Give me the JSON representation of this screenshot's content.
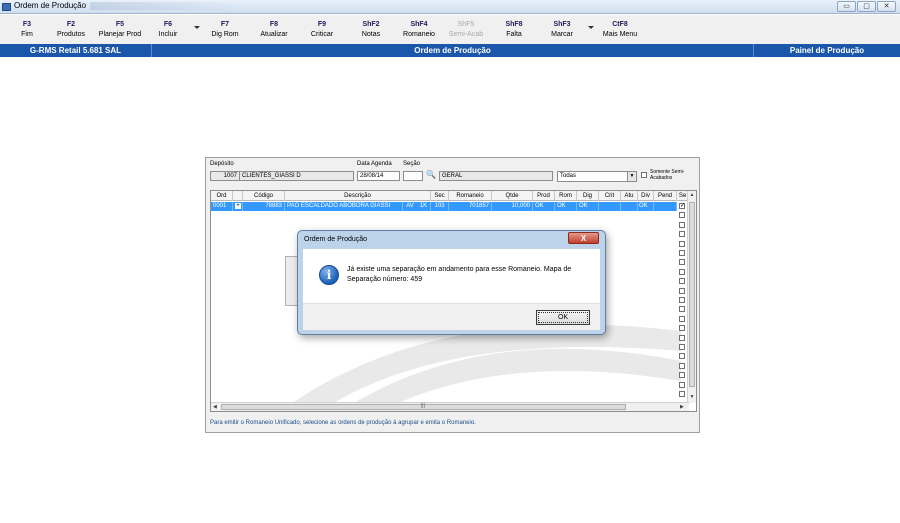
{
  "window": {
    "title": "Ordem de Produção",
    "controls": [
      "▭",
      "▢",
      "✕"
    ]
  },
  "toolbar": {
    "items": [
      {
        "key": "F3",
        "label": "Fim",
        "enabled": true
      },
      {
        "key": "F2",
        "label": "Produtos",
        "enabled": true
      },
      {
        "key": "F5",
        "label": "Planejar Prod",
        "enabled": true
      },
      {
        "key": "F6",
        "label": "Incluir",
        "enabled": true
      },
      {
        "key": "F7",
        "label": "Dig Rom",
        "enabled": true
      },
      {
        "key": "F8",
        "label": "Atualizar",
        "enabled": true
      },
      {
        "key": "F9",
        "label": "Criticar",
        "enabled": true
      },
      {
        "key": "ShF2",
        "label": "Notas",
        "enabled": true
      },
      {
        "key": "ShF4",
        "label": "Romaneio",
        "enabled": true
      },
      {
        "key": "ShF5",
        "label": "Semi-Acab",
        "enabled": false
      },
      {
        "key": "ShF8",
        "label": "Falta",
        "enabled": true
      },
      {
        "key": "ShF3",
        "label": "Marcar",
        "enabled": true
      },
      {
        "key": "CtF8",
        "label": "Mais Menu",
        "enabled": true
      }
    ]
  },
  "header": {
    "left": "G-RMS Retail 5.681 SAL",
    "center": "Ordem de Produção",
    "right": "Painel de Produção"
  },
  "filters": {
    "deposito_label": "Depósito",
    "deposito_code": "1007",
    "deposito_name": "CLIENTES_GIASSI D",
    "data_agenda_label": "Data Agenda",
    "data_agenda_value": "28/08/14",
    "secao_label": "Seção",
    "secao_code": "",
    "secao_name": "GERAL",
    "combo_value": "Todas",
    "somente_label": "Somente Semi-Acabados"
  },
  "grid": {
    "columns": [
      "Ord",
      "Código",
      "Descrição",
      "Sec",
      "Romaneio",
      "Qtde",
      "Prod",
      "Rom",
      "Dig",
      "Crit",
      "Atu",
      "Div",
      "Pend",
      "Se"
    ],
    "row": {
      "ord": "0001",
      "plus": "+",
      "codigo": "78883",
      "descricao": "PAO ESCALDADO ABOBORA GIASSI",
      "av": "AV",
      "unit": "1K",
      "sec": "103",
      "romaneio": "701857",
      "qtde": "10,000",
      "prod": "OK",
      "rom": "OK",
      "dig": "OK",
      "crit": "",
      "atu": "",
      "div": "OK",
      "pend": ""
    },
    "empty_rows": 20,
    "footer_message": "Para emitir o Romaneio Unificado, selecione as ordens de produção à agrupar e emita o Romaneio."
  },
  "dialog": {
    "title": "Ordem de Produção",
    "close": "X",
    "icon": "info-icon",
    "message": "Já existe uma separação em andamento para esse Romaneio. Mapa de Separação número: 459",
    "ok_label": "OK"
  },
  "colors": {
    "header_blue": "#1a56a9",
    "selection_blue": "#3399ff",
    "footer_text": "#1a4e8a"
  }
}
